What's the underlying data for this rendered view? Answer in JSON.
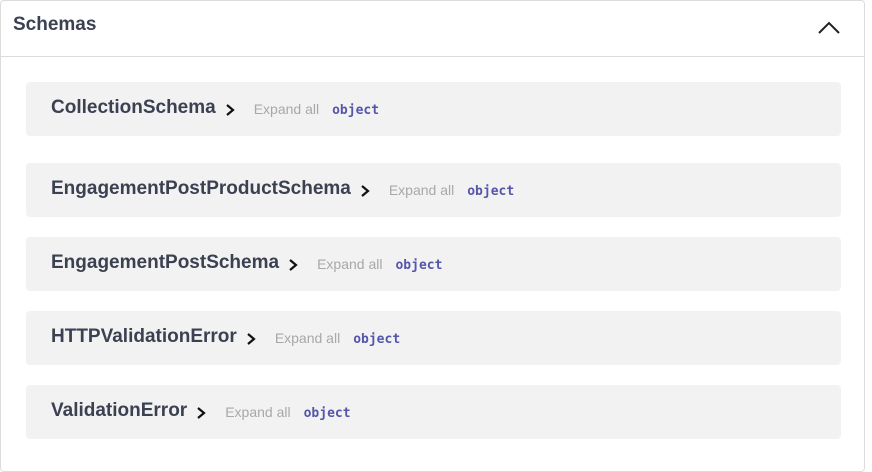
{
  "section": {
    "title": "Schemas",
    "collapse_icon": "chevron-up-icon"
  },
  "models": [
    {
      "name": "CollectionSchema",
      "expand_label": "Expand all",
      "type": "object"
    },
    {
      "name": "EngagementPostProductSchema",
      "expand_label": "Expand all",
      "type": "object"
    },
    {
      "name": "EngagementPostSchema",
      "expand_label": "Expand all",
      "type": "object"
    },
    {
      "name": "HTTPValidationError",
      "expand_label": "Expand all",
      "type": "object"
    },
    {
      "name": "ValidationError",
      "expand_label": "Expand all",
      "type": "object"
    }
  ],
  "colors": {
    "title_text": "#3b4151",
    "row_background": "#f2f2f2",
    "expand_text": "#a8a8a8",
    "type_text": "#5555aa",
    "border": "#dcdcdc"
  }
}
